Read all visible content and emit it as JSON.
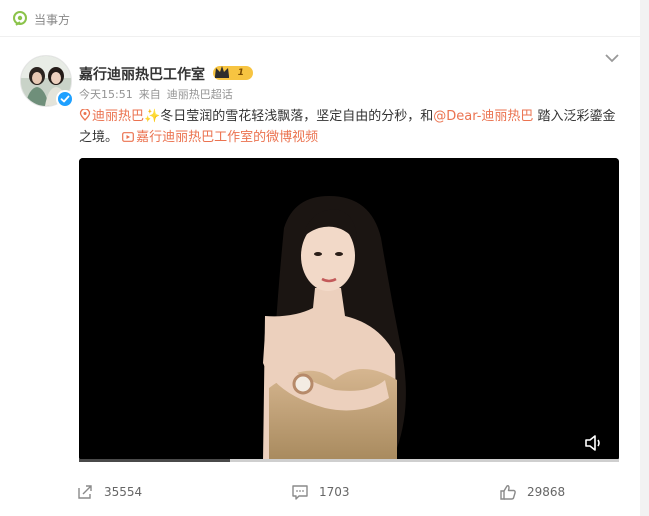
{
  "header": {
    "label": "当事方"
  },
  "post": {
    "author": "嘉行迪丽热巴工作室",
    "level": "1",
    "time": "今天15:51",
    "source_prefix": "来自",
    "source": "迪丽热巴超话",
    "content": {
      "topic": "迪丽热巴",
      "sparkle": "✨",
      "text1": "冬日莹润的雪花轻浅飘落，坚定自由的分秒，和",
      "mention": "@Dear-迪丽热巴",
      "text2": " 踏入泛彩鎏金之境。",
      "video_link": "嘉行迪丽热巴工作室的微博视频"
    },
    "video": {
      "progress": 0.28
    }
  },
  "actions": {
    "share": "35554",
    "comment": "1703",
    "like": "29868"
  },
  "colors": {
    "accent": "#eb7350",
    "verified": "#1ea0ff",
    "badge": "#f7c441"
  }
}
